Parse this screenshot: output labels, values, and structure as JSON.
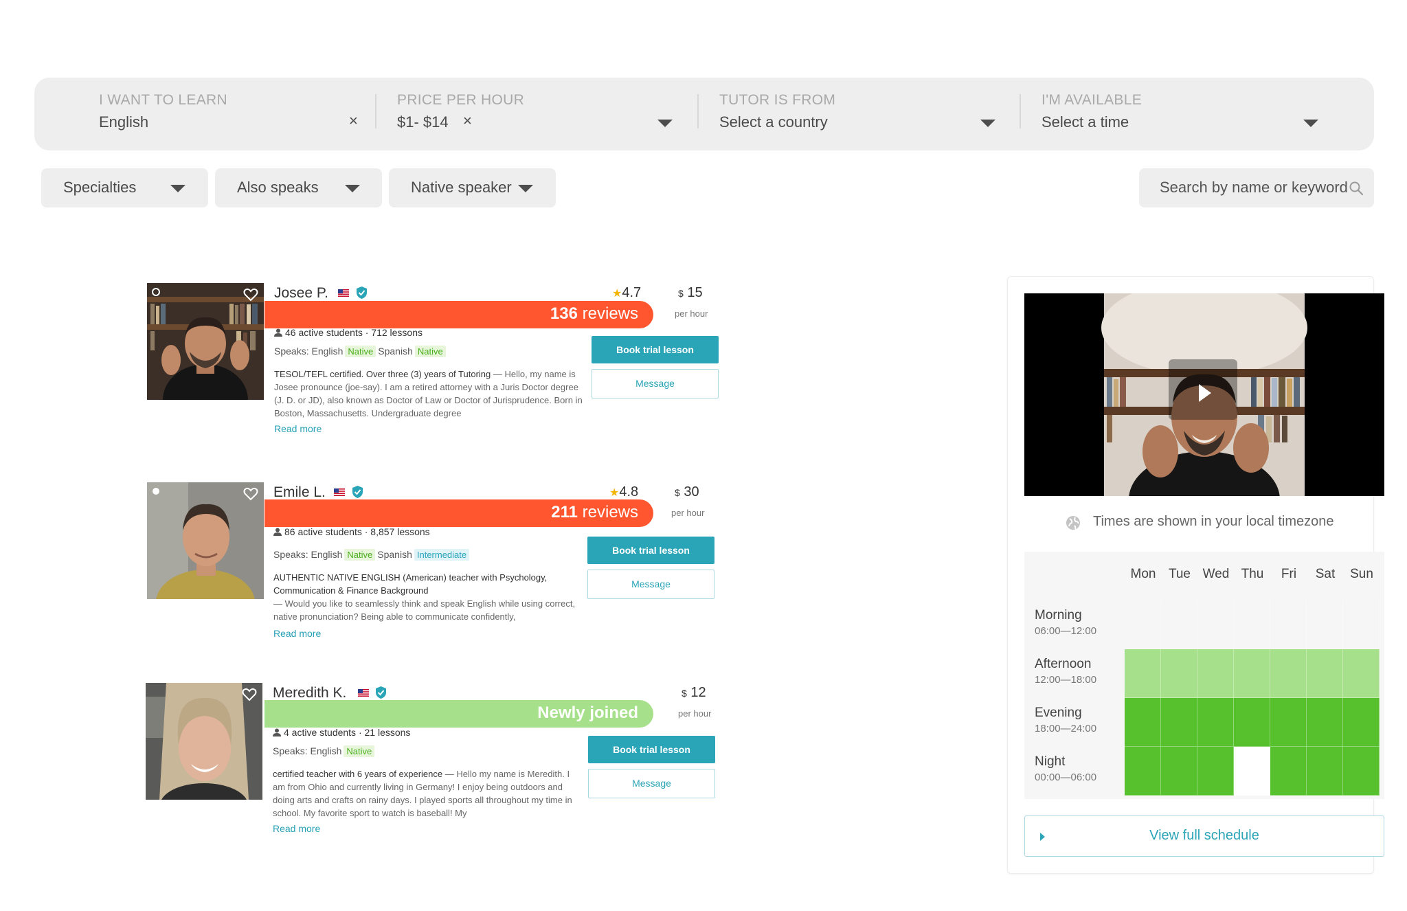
{
  "filters": {
    "learn": {
      "label": "I WANT TO LEARN",
      "value": "English",
      "clear": "×"
    },
    "price": {
      "label": "PRICE PER HOUR",
      "value": "$1- $14",
      "clear": "×"
    },
    "from": {
      "label": "TUTOR IS FROM",
      "value": "Select a country"
    },
    "available": {
      "label": "I'M AVAILABLE",
      "value": "Select a time"
    }
  },
  "chips": {
    "specialties": "Specialties",
    "also_speaks": "Also speaks",
    "native_speaker": "Native speaker"
  },
  "search": {
    "placeholder": "Search by name or keyword"
  },
  "tutors": [
    {
      "name": "Josee P.",
      "rating_star": "★",
      "rating": "4.7",
      "price_currency": "$",
      "price": "15",
      "per_hour": "per hour",
      "reviews_count": "136",
      "reviews_word": "reviews",
      "stats": "46 active students · 712 lessons",
      "speaks_label": "Speaks:",
      "languages": [
        {
          "lang": "English",
          "level": "Native"
        },
        {
          "lang": "Spanish",
          "level": "Native"
        }
      ],
      "headline": "TESOL/TEFL certified. Over three (3) years of Tutoring",
      "description": " — Hello, my name is Josee pronounce (joe-say). I am a retired attorney with a Juris Doctor degree (J. D. or JD), also known as Doctor of Law or Doctor of Jurisprudence. Born in Boston, Massachusetts. Undergraduate degree",
      "read_more": "Read more",
      "book": "Book trial lesson",
      "message": "Message"
    },
    {
      "name": "Emile L.",
      "rating_star": "★",
      "rating": "4.8",
      "price_currency": "$",
      "price": "30",
      "per_hour": "per hour",
      "reviews_count": "211",
      "reviews_word": "reviews",
      "stats": "86 active students · 8,857 lessons",
      "speaks_label": "Speaks:",
      "languages": [
        {
          "lang": "English",
          "level": "Native"
        },
        {
          "lang": "Spanish",
          "level": "Intermediate"
        }
      ],
      "headline": "AUTHENTIC NATIVE ENGLISH (American) teacher with Psychology, Communication & Finance Background",
      "description": "— Would you like to seamlessly think and speak English while using correct, native pronunciation? Being able to communicate confidently,",
      "read_more": "Read more",
      "book": "Book trial lesson",
      "message": "Message"
    },
    {
      "name": "Meredith K.",
      "price_currency": "$",
      "price": "12",
      "per_hour": "per hour",
      "newly": "Newly joined",
      "stats": "4 active students · 21 lessons",
      "speaks_label": "Speaks:",
      "languages": [
        {
          "lang": "English",
          "level": "Native"
        }
      ],
      "headline": "certified teacher with 6 years of experience",
      "description": " — Hello my name is Meredith. I am from Ohio and currently living in Germany! I enjoy being outdoors and doing arts and crafts on rainy days. I played sports all throughout my time in school. My favorite sport to watch is baseball! My",
      "read_more": "Read more",
      "book": "Book trial lesson",
      "message": "Message"
    }
  ],
  "schedule": {
    "timezone_note": "Times are shown in your local timezone",
    "days": [
      "Mon",
      "Tue",
      "Wed",
      "Thu",
      "Fri",
      "Sat",
      "Sun"
    ],
    "slots": [
      {
        "name": "Morning",
        "time": "06:00—12:00",
        "availability": [
          0,
          0,
          0,
          0,
          0,
          0,
          0
        ]
      },
      {
        "name": "Afternoon",
        "time": "12:00—18:00",
        "availability": [
          1,
          1,
          1,
          1,
          1,
          1,
          1
        ]
      },
      {
        "name": "Evening",
        "time": "18:00—24:00",
        "availability": [
          2,
          2,
          2,
          2,
          2,
          2,
          2
        ]
      },
      {
        "name": "Night",
        "time": "00:00—06:00",
        "availability": [
          2,
          2,
          2,
          0,
          2,
          2,
          2
        ]
      }
    ],
    "legend_colors": {
      "none": "#f6f6f6",
      "some": "#a7e08a",
      "full": "#56c12c"
    },
    "view_full": "View full schedule"
  },
  "colors": {
    "accent": "#2aa4b7",
    "reviews_bar": "#ff5630",
    "newly_bar": "#a7e08a",
    "native_badge": "#4caf1f"
  }
}
